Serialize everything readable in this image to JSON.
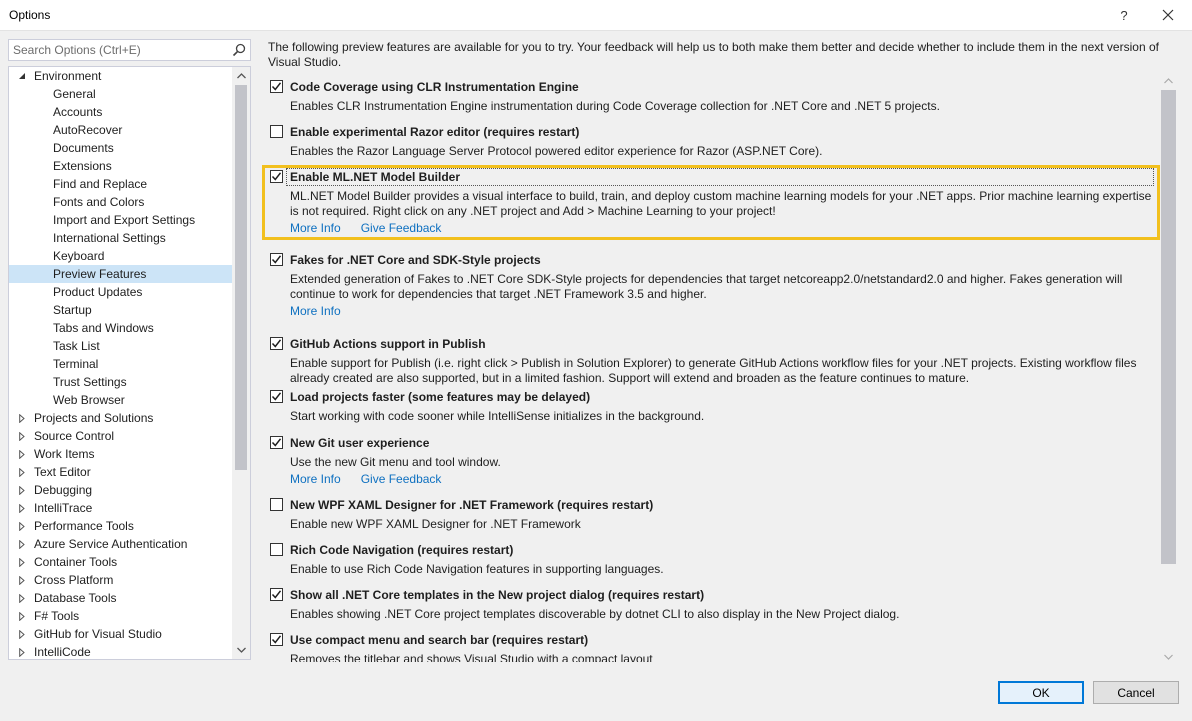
{
  "window": {
    "title": "Options",
    "help_label": "?",
    "close_icon": "close-icon"
  },
  "search": {
    "placeholder": "Search Options (Ctrl+E)",
    "icon": "search-icon"
  },
  "tree": {
    "items": [
      {
        "label": "Environment",
        "level": 0,
        "expander": "expanded"
      },
      {
        "label": "General",
        "level": 1
      },
      {
        "label": "Accounts",
        "level": 1
      },
      {
        "label": "AutoRecover",
        "level": 1
      },
      {
        "label": "Documents",
        "level": 1
      },
      {
        "label": "Extensions",
        "level": 1
      },
      {
        "label": "Find and Replace",
        "level": 1
      },
      {
        "label": "Fonts and Colors",
        "level": 1
      },
      {
        "label": "Import and Export Settings",
        "level": 1
      },
      {
        "label": "International Settings",
        "level": 1
      },
      {
        "label": "Keyboard",
        "level": 1
      },
      {
        "label": "Preview Features",
        "level": 1,
        "selected": true
      },
      {
        "label": "Product Updates",
        "level": 1
      },
      {
        "label": "Startup",
        "level": 1
      },
      {
        "label": "Tabs and Windows",
        "level": 1
      },
      {
        "label": "Task List",
        "level": 1
      },
      {
        "label": "Terminal",
        "level": 1
      },
      {
        "label": "Trust Settings",
        "level": 1
      },
      {
        "label": "Web Browser",
        "level": 1
      },
      {
        "label": "Projects and Solutions",
        "level": 0,
        "expander": "collapsed"
      },
      {
        "label": "Source Control",
        "level": 0,
        "expander": "collapsed"
      },
      {
        "label": "Work Items",
        "level": 0,
        "expander": "collapsed"
      },
      {
        "label": "Text Editor",
        "level": 0,
        "expander": "collapsed"
      },
      {
        "label": "Debugging",
        "level": 0,
        "expander": "collapsed"
      },
      {
        "label": "IntelliTrace",
        "level": 0,
        "expander": "collapsed"
      },
      {
        "label": "Performance Tools",
        "level": 0,
        "expander": "collapsed"
      },
      {
        "label": "Azure Service Authentication",
        "level": 0,
        "expander": "collapsed"
      },
      {
        "label": "Container Tools",
        "level": 0,
        "expander": "collapsed"
      },
      {
        "label": "Cross Platform",
        "level": 0,
        "expander": "collapsed"
      },
      {
        "label": "Database Tools",
        "level": 0,
        "expander": "collapsed"
      },
      {
        "label": "F# Tools",
        "level": 0,
        "expander": "collapsed"
      },
      {
        "label": "GitHub for Visual Studio",
        "level": 0,
        "expander": "collapsed"
      },
      {
        "label": "IntelliCode",
        "level": 0,
        "expander": "collapsed"
      }
    ]
  },
  "intro": "The following preview features are available for you to try. Your feedback will help us to both make them better and decide whether to include them in the next version of Visual Studio.",
  "features": [
    {
      "name": "Code Coverage using CLR Instrumentation Engine",
      "checked": true,
      "description": "Enables CLR Instrumentation Engine instrumentation during Code Coverage collection for .NET Core and .NET 5 projects.",
      "links": []
    },
    {
      "name": "Enable experimental Razor editor (requires restart)",
      "checked": false,
      "description": "Enables the Razor Language Server Protocol powered editor experience for Razor (ASP.NET Core).",
      "links": []
    },
    {
      "name": "Enable ML.NET Model Builder",
      "checked": true,
      "highlighted": true,
      "description": "ML.NET Model Builder provides a visual interface to build, train, and deploy custom machine learning models for your .NET apps. Prior machine learning expertise is not required. Right click on any .NET project and Add > Machine Learning to your project!",
      "links": [
        "More Info",
        "Give Feedback"
      ]
    },
    {
      "name": "Fakes for .NET Core and SDK-Style projects",
      "checked": true,
      "description": "Extended generation of Fakes to .NET Core SDK-Style projects for dependencies that target netcoreapp2.0/netstandard2.0 and higher. Fakes generation will continue to work for dependencies that target .NET Framework 3.5 and higher.",
      "links": [
        "More Info"
      ]
    },
    {
      "name": "GitHub Actions support in Publish",
      "checked": true,
      "description": "Enable support for Publish (i.e. right click > Publish in Solution Explorer) to generate GitHub Actions workflow files for your .NET projects. Existing workflow files already created are also supported, but in a limited fashion. Support will extend and broaden as the feature continues to mature.",
      "links": []
    },
    {
      "name": "Load projects faster (some features may be delayed)",
      "checked": true,
      "description": "Start working with code sooner while IntelliSense initializes in the background.",
      "links": []
    },
    {
      "name": "New Git user experience",
      "checked": true,
      "description": "Use the new Git menu and tool window.",
      "links": [
        "More Info",
        "Give Feedback"
      ]
    },
    {
      "name": "New WPF XAML Designer for .NET Framework (requires restart)",
      "checked": false,
      "description": "Enable new WPF XAML Designer for .NET Framework",
      "links": []
    },
    {
      "name": "Rich Code Navigation (requires restart)",
      "checked": false,
      "description": "Enable to use Rich Code Navigation features in supporting languages.",
      "links": []
    },
    {
      "name": "Show all .NET Core templates in the New project dialog (requires restart)",
      "checked": true,
      "description": "Enables showing .NET Core project templates discoverable by dotnet CLI to also display in the New Project dialog.",
      "links": []
    },
    {
      "name": "Use compact menu and search bar (requires restart)",
      "checked": true,
      "description": "Removes the titlebar and shows Visual Studio with a compact layout",
      "links": []
    }
  ],
  "buttons": {
    "ok": "OK",
    "cancel": "Cancel"
  },
  "colors": {
    "highlight_border": "#f2c01e",
    "link": "#0e70c0",
    "selection": "#cce4f7"
  }
}
